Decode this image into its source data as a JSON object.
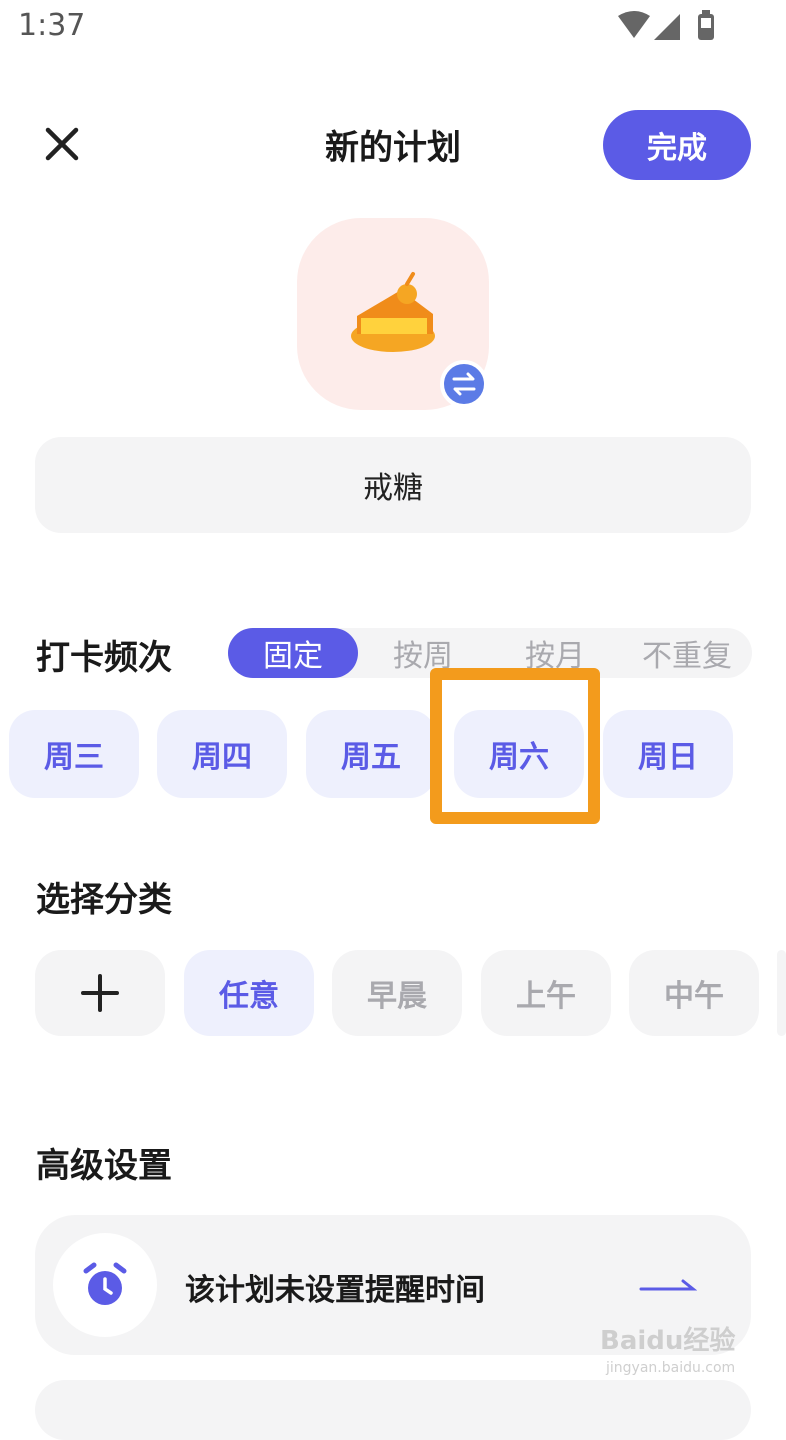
{
  "status_bar": {
    "time": "1:37"
  },
  "header": {
    "title": "新的计划",
    "done_label": "完成"
  },
  "plan": {
    "name": "戒糖",
    "icon": "cake-icon"
  },
  "frequency": {
    "heading": "打卡频次",
    "options": [
      "固定",
      "按周",
      "按月",
      "不重复"
    ],
    "selected": "固定",
    "days": [
      "周三",
      "周四",
      "周五",
      "周六",
      "周日"
    ]
  },
  "category": {
    "heading": "选择分类",
    "add_icon": "plus-icon",
    "options": [
      "任意",
      "早晨",
      "上午",
      "中午"
    ],
    "selected": "任意"
  },
  "advanced": {
    "heading": "高级设置",
    "reminder_text": "该计划未设置提醒时间"
  },
  "watermark": {
    "brand": "Baidu经验",
    "url": "jingyan.baidu.com"
  },
  "colors": {
    "accent": "#5b5be6",
    "chip_bg": "#eef0fd",
    "highlight": "#f39b1c",
    "tile_bg": "#fdecea"
  }
}
